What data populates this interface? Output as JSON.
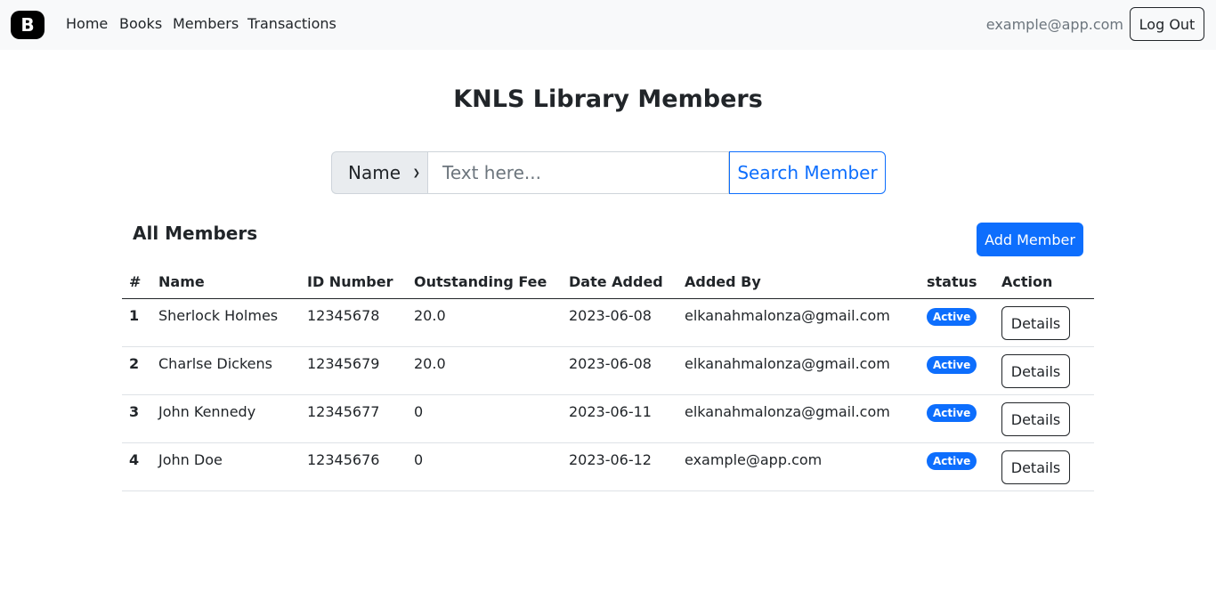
{
  "navbar": {
    "brand": "B",
    "links": [
      "Home",
      "Books",
      "Members",
      "Transactions"
    ],
    "user_email": "example@app.com",
    "logout_label": "Log Out"
  },
  "page_title": "KNLS Library Members",
  "search": {
    "field_selected": "Name",
    "placeholder": "Text here...",
    "button_label": "Search Member"
  },
  "section_title": "All Members",
  "add_button_label": "Add Member",
  "table": {
    "headers": [
      "#",
      "Name",
      "ID Number",
      "Outstanding Fee",
      "Date Added",
      "Added By",
      "status",
      "Action"
    ],
    "rows": [
      {
        "num": "1",
        "name": "Sherlock Holmes",
        "id": "12345678",
        "fee": "20.0",
        "date": "2023-06-08",
        "added_by": "elkanahmalonza@gmail.com",
        "status": "Active",
        "action": "Details"
      },
      {
        "num": "2",
        "name": "Charlse Dickens",
        "id": "12345679",
        "fee": "20.0",
        "date": "2023-06-08",
        "added_by": "elkanahmalonza@gmail.com",
        "status": "Active",
        "action": "Details"
      },
      {
        "num": "3",
        "name": "John Kennedy",
        "id": "12345677",
        "fee": "0",
        "date": "2023-06-11",
        "added_by": "elkanahmalonza@gmail.com",
        "status": "Active",
        "action": "Details"
      },
      {
        "num": "4",
        "name": "John Doe",
        "id": "12345676",
        "fee": "0",
        "date": "2023-06-12",
        "added_by": "example@app.com",
        "status": "Active",
        "action": "Details"
      }
    ]
  },
  "colors": {
    "primary": "#0d6efd",
    "navbar_bg": "#f8f9fa",
    "text": "#212529",
    "muted": "#6c757d"
  }
}
